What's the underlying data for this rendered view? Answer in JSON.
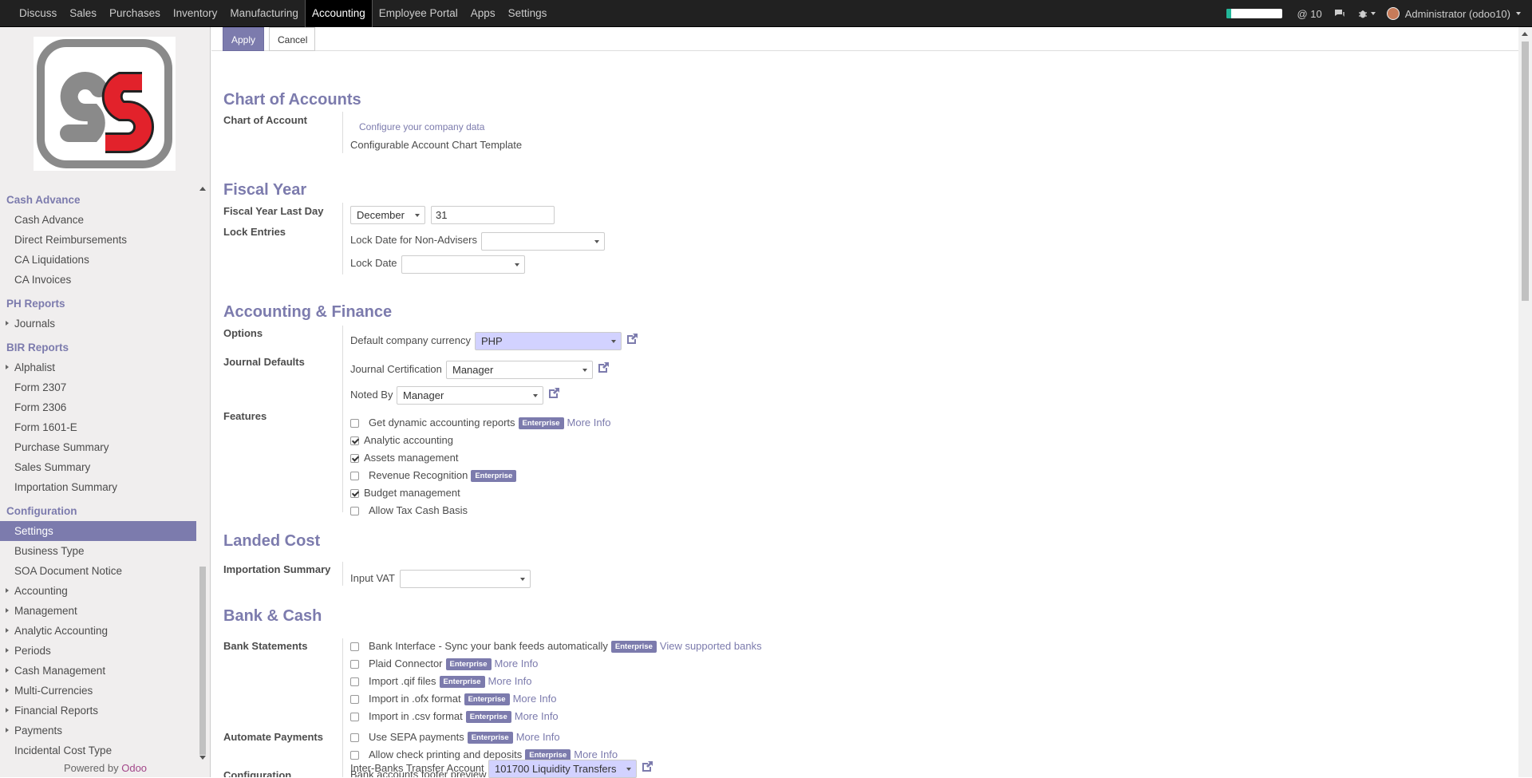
{
  "topbar": {
    "menu": [
      "Discuss",
      "Sales",
      "Purchases",
      "Inventory",
      "Manufacturing",
      "Accounting",
      "Employee Portal",
      "Apps",
      "Settings"
    ],
    "active": "Accounting",
    "progress": 0.08,
    "mentions_count": "@ 10",
    "user": "Administrator (odoo10)"
  },
  "sidebar": {
    "sections": [
      {
        "title": "Cash Advance",
        "items": [
          {
            "label": "Cash Advance"
          },
          {
            "label": "Direct Reimbursements"
          },
          {
            "label": "CA Liquidations"
          },
          {
            "label": "CA Invoices"
          }
        ]
      },
      {
        "title": "PH Reports",
        "items": [
          {
            "label": "Journals",
            "caret": true
          }
        ]
      },
      {
        "title": "BIR Reports",
        "items": [
          {
            "label": "Alphalist",
            "caret": true
          },
          {
            "label": "Form 2307"
          },
          {
            "label": "Form 2306"
          },
          {
            "label": "Form 1601-E"
          },
          {
            "label": "Purchase Summary"
          },
          {
            "label": "Sales Summary"
          },
          {
            "label": "Importation Summary"
          }
        ]
      },
      {
        "title": "Configuration",
        "items": [
          {
            "label": "Settings",
            "active": true
          },
          {
            "label": "Business Type"
          },
          {
            "label": "SOA Document Notice"
          },
          {
            "label": "Accounting",
            "caret": true
          },
          {
            "label": "Management",
            "caret": true
          },
          {
            "label": "Analytic Accounting",
            "caret": true
          },
          {
            "label": "Periods",
            "caret": true
          },
          {
            "label": "Cash Management",
            "caret": true
          },
          {
            "label": "Multi-Currencies",
            "caret": true
          },
          {
            "label": "Financial Reports",
            "caret": true
          },
          {
            "label": "Payments",
            "caret": true
          },
          {
            "label": "Incidental Cost Type"
          }
        ]
      }
    ],
    "powered_prefix": "Powered by",
    "powered_brand": "Odoo"
  },
  "control_panel": {
    "apply": "Apply",
    "cancel": "Cancel"
  },
  "form": {
    "chart_heading": "Chart of Accounts",
    "chart_label": "Chart of Account",
    "configure_link": "Configure your company data",
    "chart_template": "Configurable Account Chart Template",
    "fiscal_heading": "Fiscal Year",
    "fiscal_last_day_label": "Fiscal Year Last Day",
    "fiscal_month": "December",
    "fiscal_day": "31",
    "lock_entries_label": "Lock Entries",
    "lock_non_advisers_label": "Lock Date for Non-Advisers",
    "lock_date_label": "Lock Date",
    "af_heading": "Accounting & Finance",
    "options_label": "Options",
    "currency_label": "Default company currency",
    "currency_value": "PHP",
    "journal_defaults_label": "Journal Defaults",
    "journal_cert_label": "Journal Certification",
    "journal_cert_value": "Manager",
    "noted_by_label": "Noted By",
    "noted_by_value": "Manager",
    "features_label": "Features",
    "features": [
      {
        "label": "Get dynamic accounting reports",
        "checked": false,
        "enterprise": true,
        "more": "More Info"
      },
      {
        "label": "Analytic accounting",
        "checked": true
      },
      {
        "label": "Assets management",
        "checked": true
      },
      {
        "label": "Revenue Recognition",
        "checked": false,
        "enterprise": true
      },
      {
        "label": "Budget management",
        "checked": true
      },
      {
        "label": "Allow Tax Cash Basis",
        "checked": false
      }
    ],
    "enterprise_badge": "Enterprise",
    "landed_heading": "Landed Cost",
    "importation_label": "Importation Summary",
    "input_vat_label": "Input VAT",
    "bank_heading": "Bank & Cash",
    "bank_statements_label": "Bank Statements",
    "bank_statements": [
      {
        "label": "Bank Interface - Sync your bank feeds automatically",
        "more": "View supported banks"
      },
      {
        "label": "Plaid Connector",
        "more": "More Info"
      },
      {
        "label": "Import .qif files",
        "more": "More Info"
      },
      {
        "label": "Import in .ofx format",
        "more": "More Info"
      },
      {
        "label": "Import in .csv format",
        "more": "More Info"
      }
    ],
    "automate_label": "Automate Payments",
    "automate": [
      {
        "label": "Use SEPA payments",
        "more": "More Info"
      },
      {
        "label": "Allow check printing and deposits",
        "more": "More Info"
      }
    ],
    "configuration_label": "Configuration",
    "footer_preview": "Bank accounts footer preview",
    "interbank_label": "Inter-Banks Transfer Account",
    "interbank_value": "101700 Liquidity Transfers"
  }
}
